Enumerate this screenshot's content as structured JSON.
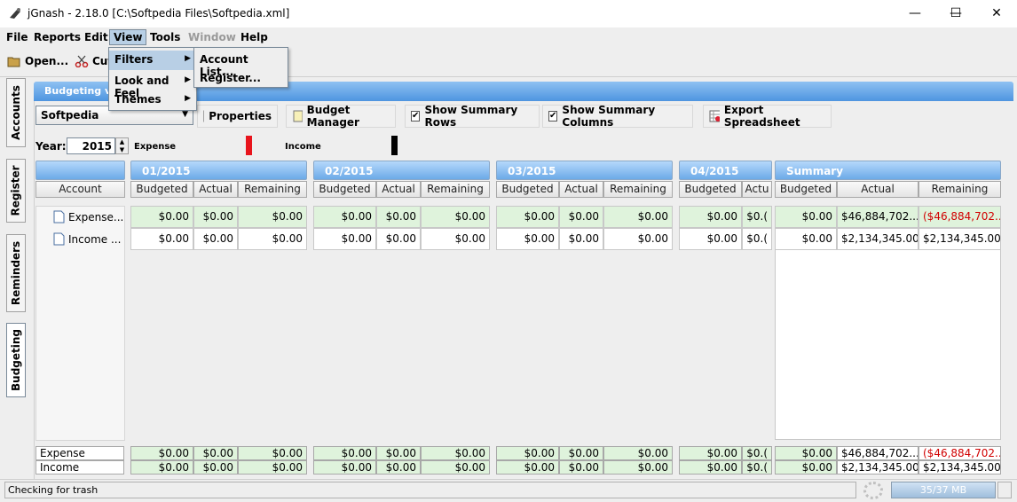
{
  "window": {
    "title": "jGnash - 2.18.0  [C:\\Softpedia Files\\Softpedia.xml]",
    "min": "—",
    "max": "☐",
    "close": "✕"
  },
  "menubar": {
    "file": "File",
    "reports": "Reports",
    "edit": "Edit",
    "view": "View",
    "tools": "Tools",
    "window": "Window",
    "help": "Help"
  },
  "toolbar": {
    "open": "Open...",
    "cut": "Cut"
  },
  "view_menu": {
    "filters": "Filters",
    "look_and_feel": "Look and Feel",
    "themes": "Themes"
  },
  "filters_submenu": {
    "account_list": "Account List...",
    "register": "Register..."
  },
  "side_tabs": {
    "accounts": "Accounts",
    "register": "Register",
    "reminders": "Reminders",
    "budgeting": "Budgeting"
  },
  "panel": {
    "header": "Budgeting view",
    "budget_select": "Softpedia",
    "properties": "Properties",
    "budget_manager": "Budget Manager",
    "show_summary_rows": "Show Summary Rows",
    "show_summary_columns": "Show Summary Columns",
    "export_spreadsheet": "Export Spreadsheet",
    "year_label": "Year:",
    "year_value": "2015",
    "legend_expense": "Expense",
    "legend_income": "Income",
    "expense_color": "#e8141c",
    "income_color": "#000000"
  },
  "account_table": {
    "header": "Account",
    "rows": [
      "Expense...",
      "Income ..."
    ]
  },
  "periods": [
    {
      "label": "01/2015",
      "cols": [
        "Budgeted",
        "Actual",
        "Remaining"
      ],
      "rows": [
        [
          "$0.00",
          "$0.00",
          "$0.00"
        ],
        [
          "$0.00",
          "$0.00",
          "$0.00"
        ]
      ]
    },
    {
      "label": "02/2015",
      "cols": [
        "Budgeted",
        "Actual",
        "Remaining"
      ],
      "rows": [
        [
          "$0.00",
          "$0.00",
          "$0.00"
        ],
        [
          "$0.00",
          "$0.00",
          "$0.00"
        ]
      ]
    },
    {
      "label": "03/2015",
      "cols": [
        "Budgeted",
        "Actual",
        "Remaining"
      ],
      "rows": [
        [
          "$0.00",
          "$0.00",
          "$0.00"
        ],
        [
          "$0.00",
          "$0.00",
          "$0.00"
        ]
      ]
    },
    {
      "label": "04/2015",
      "cols": [
        "Budgeted",
        "Actu"
      ],
      "rows": [
        [
          "$0.00",
          "$0.("
        ],
        [
          "$0.00",
          "$0.("
        ]
      ]
    }
  ],
  "summary": {
    "label": "Summary",
    "cols": [
      "Budgeted",
      "Actual",
      "Remaining"
    ],
    "rows": [
      [
        "$0.00",
        "$46,884,702....",
        "($46,884,702...."
      ],
      [
        "$0.00",
        "$2,134,345.00",
        "$2,134,345.00"
      ]
    ]
  },
  "footer": {
    "labels": [
      "Expense",
      "Income"
    ],
    "periods": [
      [
        [
          "$0.00",
          "$0.00",
          "$0.00"
        ],
        [
          "$0.00",
          "$0.00",
          "$0.00"
        ]
      ],
      [
        [
          "$0.00",
          "$0.00",
          "$0.00"
        ],
        [
          "$0.00",
          "$0.00",
          "$0.00"
        ]
      ],
      [
        [
          "$0.00",
          "$0.00",
          "$0.00"
        ],
        [
          "$0.00",
          "$0.00",
          "$0.00"
        ]
      ],
      [
        [
          "$0.00",
          "$0.("
        ],
        [
          "$0.00",
          "$0.("
        ]
      ]
    ],
    "summary": [
      [
        "$0.00",
        "$46,884,702....",
        "($46,884,702...."
      ],
      [
        "$0.00",
        "$2,134,345.00",
        "$2,134,345.00"
      ]
    ]
  },
  "status": {
    "message": "Checking for trash",
    "memory": "35/37 MB"
  }
}
